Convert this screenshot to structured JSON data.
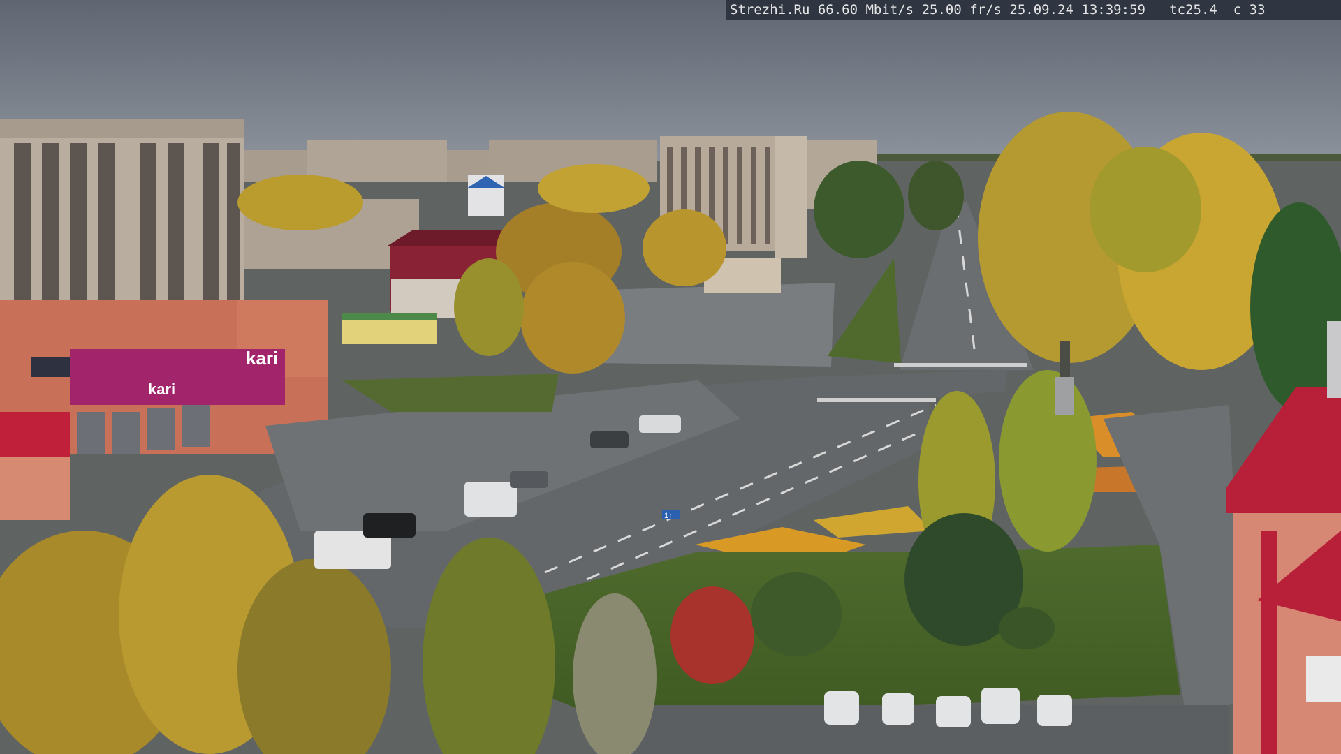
{
  "camera_osd": {
    "site": "Strezhi.Ru",
    "bitrate": "66.60 Mbit/s",
    "framerate": "25.00 fr/s",
    "date": "25.09.24",
    "time": "13:39:59",
    "tc": "tc25.4",
    "c": "c 33"
  },
  "store_signs": {
    "brand": "kari",
    "facade_brand": "kari"
  },
  "road_sign": {
    "lane": "1↑"
  },
  "colors": {
    "sky": "#6f7682",
    "asphalt": "#6b6e71",
    "foliage": "#b99a2c",
    "store_facade": "#a2246a",
    "kari_red": "#c1203a"
  }
}
